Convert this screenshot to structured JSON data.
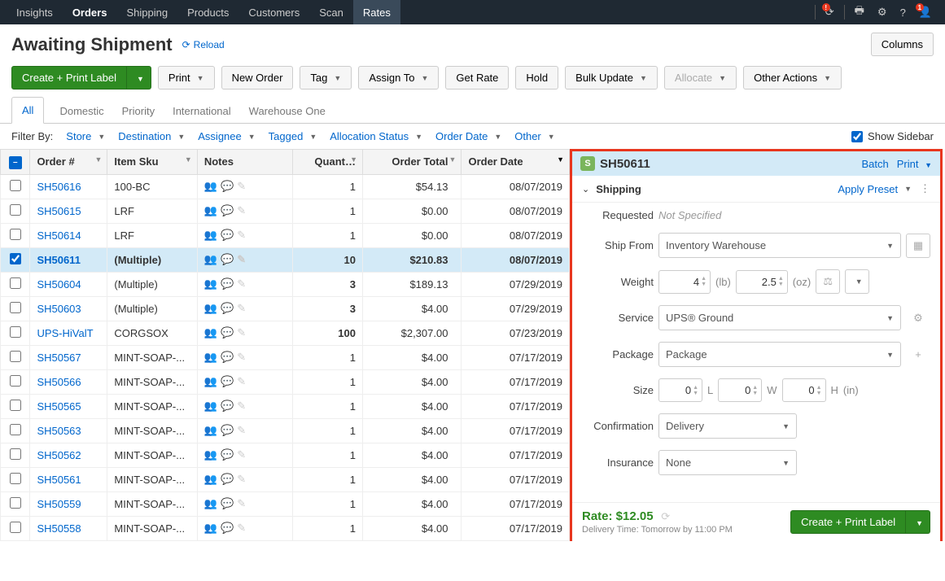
{
  "topnav": {
    "items": [
      "Insights",
      "Orders",
      "Shipping",
      "Products",
      "Customers",
      "Scan",
      "Rates"
    ],
    "active": "Orders",
    "highlighted": "Rates",
    "alert_badge": "!",
    "account_badge": "1"
  },
  "page": {
    "title": "Awaiting Shipment",
    "reload": "Reload",
    "columns_btn": "Columns"
  },
  "toolbar": {
    "create_print": "Create + Print Label",
    "print": "Print",
    "new_order": "New Order",
    "tag": "Tag",
    "assign_to": "Assign To",
    "get_rate": "Get Rate",
    "hold": "Hold",
    "bulk_update": "Bulk Update",
    "allocate": "Allocate",
    "other_actions": "Other Actions"
  },
  "tabs": {
    "items": [
      "All",
      "Domestic",
      "Priority",
      "International",
      "Warehouse One"
    ],
    "active": "All"
  },
  "filters": {
    "label": "Filter By:",
    "items": [
      "Store",
      "Destination",
      "Assignee",
      "Tagged",
      "Allocation Status",
      "Order Date",
      "Other"
    ],
    "show_sidebar": "Show Sidebar"
  },
  "table": {
    "headers": {
      "order": "Order #",
      "sku": "Item Sku",
      "notes": "Notes",
      "qty": "Quant…",
      "total": "Order Total",
      "date": "Order Date"
    },
    "rows": [
      {
        "id": "SH50616",
        "sku": "100-BC",
        "qty": "1",
        "total": "$54.13",
        "date": "08/07/2019",
        "selected": false
      },
      {
        "id": "SH50615",
        "sku": "LRF",
        "qty": "1",
        "total": "$0.00",
        "date": "08/07/2019",
        "selected": false
      },
      {
        "id": "SH50614",
        "sku": "LRF",
        "qty": "1",
        "total": "$0.00",
        "date": "08/07/2019",
        "selected": false
      },
      {
        "id": "SH50611",
        "sku": "(Multiple)",
        "qty": "10",
        "total": "$210.83",
        "date": "08/07/2019",
        "selected": true
      },
      {
        "id": "SH50604",
        "sku": "(Multiple)",
        "qty": "3",
        "total": "$189.13",
        "date": "07/29/2019",
        "selected": false
      },
      {
        "id": "SH50603",
        "sku": "(Multiple)",
        "qty": "3",
        "total": "$4.00",
        "date": "07/29/2019",
        "selected": false
      },
      {
        "id": "UPS-HiValT",
        "sku": "CORGSOX",
        "qty": "100",
        "total": "$2,307.00",
        "date": "07/23/2019",
        "selected": false
      },
      {
        "id": "SH50567",
        "sku": "MINT-SOAP-...",
        "qty": "1",
        "total": "$4.00",
        "date": "07/17/2019",
        "selected": false
      },
      {
        "id": "SH50566",
        "sku": "MINT-SOAP-...",
        "qty": "1",
        "total": "$4.00",
        "date": "07/17/2019",
        "selected": false,
        "has_note": true
      },
      {
        "id": "SH50565",
        "sku": "MINT-SOAP-...",
        "qty": "1",
        "total": "$4.00",
        "date": "07/17/2019",
        "selected": false
      },
      {
        "id": "SH50563",
        "sku": "MINT-SOAP-...",
        "qty": "1",
        "total": "$4.00",
        "date": "07/17/2019",
        "selected": false
      },
      {
        "id": "SH50562",
        "sku": "MINT-SOAP-...",
        "qty": "1",
        "total": "$4.00",
        "date": "07/17/2019",
        "selected": false
      },
      {
        "id": "SH50561",
        "sku": "MINT-SOAP-...",
        "qty": "1",
        "total": "$4.00",
        "date": "07/17/2019",
        "selected": false
      },
      {
        "id": "SH50559",
        "sku": "MINT-SOAP-...",
        "qty": "1",
        "total": "$4.00",
        "date": "07/17/2019",
        "selected": false
      },
      {
        "id": "SH50558",
        "sku": "MINT-SOAP-...",
        "qty": "1",
        "total": "$4.00",
        "date": "07/17/2019",
        "selected": false
      }
    ]
  },
  "panel": {
    "order_id": "SH50611",
    "batch": "Batch",
    "print": "Print",
    "section": "Shipping",
    "apply_preset": "Apply Preset",
    "requested_label": "Requested",
    "requested_value": "Not Specified",
    "ship_from_label": "Ship From",
    "ship_from_value": "Inventory Warehouse",
    "weight_label": "Weight",
    "weight_lb": "4",
    "weight_oz": "2.5",
    "unit_lb": "(lb)",
    "unit_oz": "(oz)",
    "service_label": "Service",
    "service_value": "UPS® Ground",
    "package_label": "Package",
    "package_value": "Package",
    "size_label": "Size",
    "size_l": "0",
    "size_w": "0",
    "size_h": "0",
    "size_l_u": "L",
    "size_w_u": "W",
    "size_h_u": "H",
    "size_in": "(in)",
    "confirmation_label": "Confirmation",
    "confirmation_value": "Delivery",
    "insurance_label": "Insurance",
    "insurance_value": "None",
    "rate_label": "Rate: $12.05",
    "delivery_time": "Delivery Time:  Tomorrow by 11:00 PM",
    "create_label": "Create + Print Label"
  }
}
